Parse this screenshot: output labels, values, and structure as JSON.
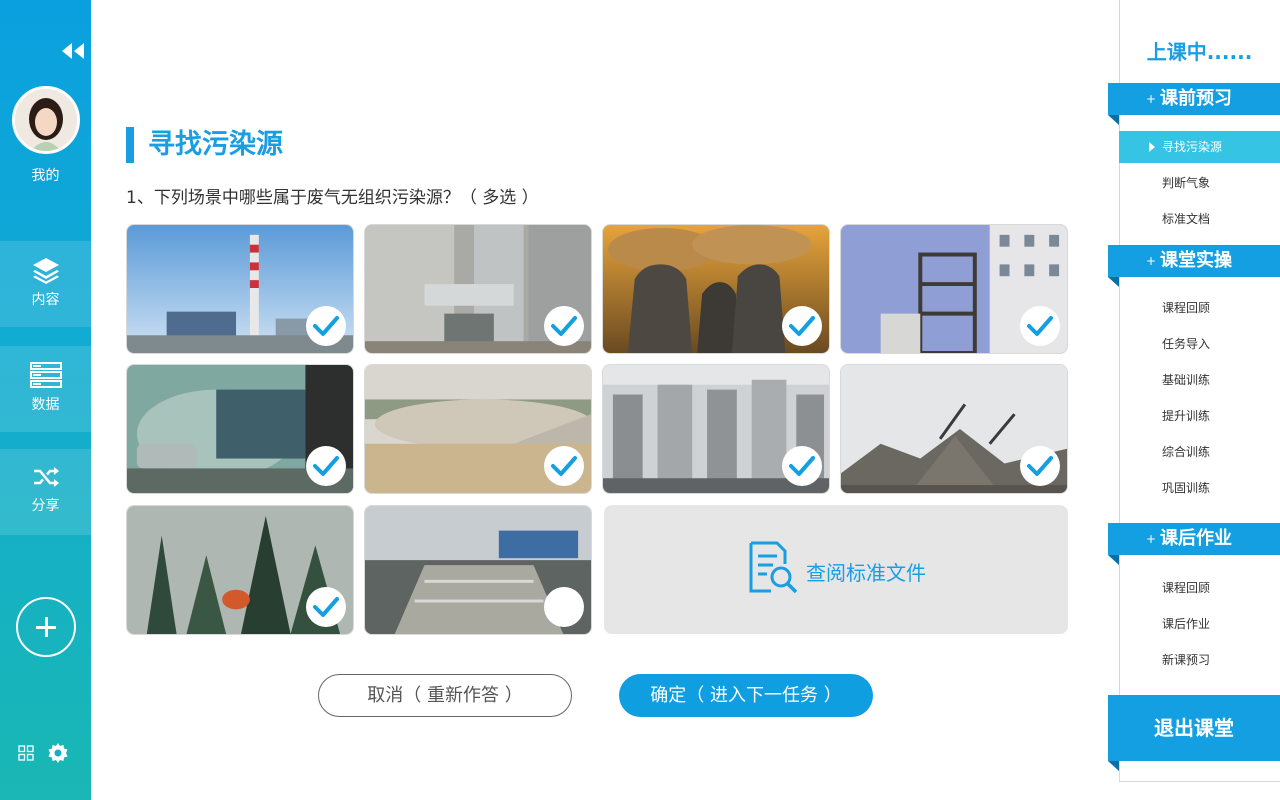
{
  "sidebar": {
    "me_label": "我的",
    "nav": [
      {
        "label": "内容",
        "icon": "layers-icon"
      },
      {
        "label": "数据",
        "icon": "server-icon"
      },
      {
        "label": "分享",
        "icon": "shuffle-icon"
      }
    ]
  },
  "main": {
    "title": "寻找污染源",
    "question": "1、下列场景中哪些属于废气无组织污染源？（ 多选 ）",
    "images": [
      {
        "scene": "power-plant-chimney",
        "selected": true
      },
      {
        "scene": "industrial-ducts",
        "selected": true
      },
      {
        "scene": "cooling-towers",
        "selected": true
      },
      {
        "scene": "steel-structure",
        "selected": true
      },
      {
        "scene": "vehicle-exhaust",
        "selected": true
      },
      {
        "scene": "dusty-construction",
        "selected": true
      },
      {
        "scene": "building-ventilation",
        "selected": true
      },
      {
        "scene": "gravel-piles",
        "selected": true
      },
      {
        "scene": "forest-fire",
        "selected": true
      },
      {
        "scene": "wastewater-treatment",
        "selected": false
      }
    ],
    "doc_label": "查阅标准文件",
    "cancel_label": "取消（ 重新作答 ）",
    "confirm_label": "确定（ 进入下一任务 ）"
  },
  "right": {
    "status": "上课中......",
    "sections": [
      {
        "title": "课前预习",
        "items": [
          "寻找污染源",
          "判断气象",
          "标准文档"
        ]
      },
      {
        "title": "课堂实操",
        "items": [
          "课程回顾",
          "任务导入",
          "基础训练",
          "提升训练",
          "综合训练",
          "巩固训练"
        ]
      },
      {
        "title": "课后作业",
        "items": [
          "课程回顾",
          "课后作业",
          "新课预习"
        ]
      }
    ],
    "exit_label": "退出课堂"
  },
  "colors": {
    "accent": "#1a9ee2",
    "active_item": "#36c4e4"
  }
}
